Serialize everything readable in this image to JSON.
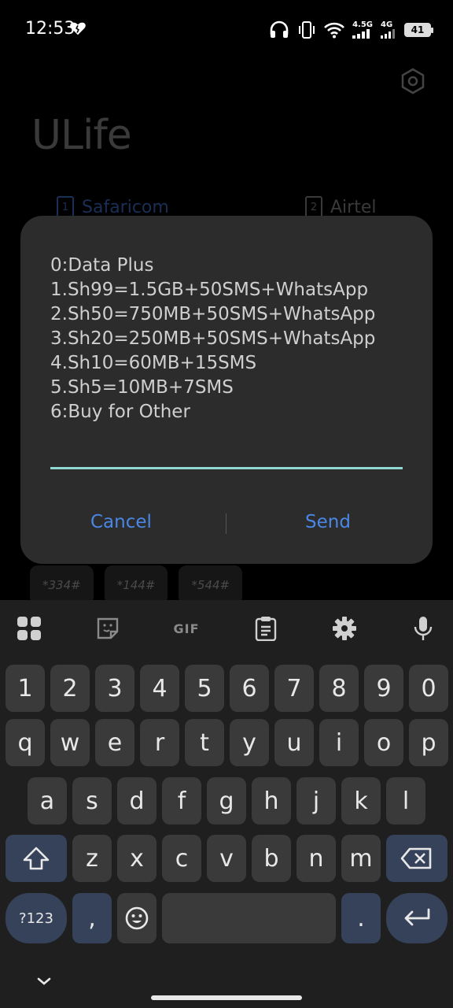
{
  "status_bar": {
    "time": "12:53",
    "network_1": "4.5G",
    "network_2": "4G",
    "battery": "41"
  },
  "app": {
    "title": "ULife",
    "sim_tabs": [
      {
        "slot": "1",
        "label": "Safaricom"
      },
      {
        "slot": "2",
        "label": "Airtel"
      }
    ],
    "codes": [
      "*334#",
      "*144#",
      "*544#"
    ]
  },
  "dialog": {
    "lines": [
      "0:Data Plus",
      "1.Sh99=1.5GB+50SMS+WhatsApp",
      "2.Sh50=750MB+50SMS+WhatsApp",
      "3.Sh20=250MB+50SMS+WhatsApp",
      "4.Sh10=60MB+15SMS",
      "5.Sh5=10MB+7SMS",
      "6:Buy for Other"
    ],
    "input_value": "",
    "cancel_label": "Cancel",
    "send_label": "Send"
  },
  "keyboard": {
    "toolbar": {
      "gif_label": "GIF",
      "icons": [
        "apps-grid-icon",
        "sticker-icon",
        "gif-icon",
        "clipboard-icon",
        "gear-icon",
        "microphone-icon"
      ]
    },
    "rows": {
      "numbers": [
        "1",
        "2",
        "3",
        "4",
        "5",
        "6",
        "7",
        "8",
        "9",
        "0"
      ],
      "row1": [
        "q",
        "w",
        "e",
        "r",
        "t",
        "y",
        "u",
        "i",
        "o",
        "p"
      ],
      "row2": [
        "a",
        "s",
        "d",
        "f",
        "g",
        "h",
        "j",
        "k",
        "l"
      ],
      "row3": [
        "z",
        "x",
        "c",
        "v",
        "b",
        "n",
        "m"
      ]
    },
    "symbols_label": "?123",
    "comma": ",",
    "period": ".",
    "accent_color": "#35425a"
  }
}
